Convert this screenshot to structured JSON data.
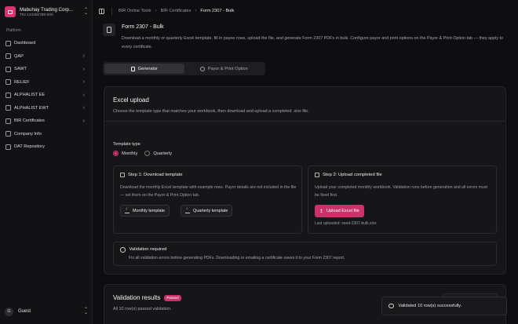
{
  "org": {
    "name": "Mabuhay Trading Corp...",
    "tin": "TIN 123456789-000"
  },
  "sidebar": {
    "section_title": "Platform",
    "items": [
      {
        "label": "Dashboard",
        "has_chevron": false
      },
      {
        "label": "QAP",
        "has_chevron": true
      },
      {
        "label": "SAWT",
        "has_chevron": true
      },
      {
        "label": "RELIEF",
        "has_chevron": true
      },
      {
        "label": "ALPHALIST EE",
        "has_chevron": true
      },
      {
        "label": "ALPHALIST EWT",
        "has_chevron": true
      },
      {
        "label": "BIR Certificates",
        "has_chevron": true
      },
      {
        "label": "Company Info",
        "has_chevron": false
      },
      {
        "label": "DAT Repository",
        "has_chevron": false
      }
    ],
    "user": {
      "initial": "G",
      "name": "Guest"
    }
  },
  "breadcrumb": {
    "items": [
      "BIR Online Tools",
      "BIR Certificates",
      "Form 2307 - Bulk"
    ],
    "separator": "›"
  },
  "header": {
    "title": "Form 2307 - Bulk",
    "description": "Download a monthly or quarterly Excel template, fill in payee rows, upload the file, and generate Form 2307 PDFs in bulk. Configure payor and print options on the Payor & Print Option tab — they apply to every certificate."
  },
  "tabs": [
    {
      "label": "Generator",
      "active": true
    },
    {
      "label": "Payor & Print Option",
      "active": false
    }
  ],
  "excel_upload": {
    "title": "Excel upload",
    "subtitle": "Choose the template type that matches your workbook, then download and upload a completed .xlsx file.",
    "template_type_label": "Template type",
    "options": [
      {
        "label": "Monthly",
        "selected": true
      },
      {
        "label": "Quarterly",
        "selected": false
      }
    ],
    "step1": {
      "title": "Step 1: Download template",
      "text": "Download the monthly Excel template with example rows. Payor details are not included in the file — set them on the Payor & Print Option tab.",
      "monthly_btn": "Monthly template",
      "quarterly_btn": "Quarterly template"
    },
    "step2": {
      "title": "Step 2: Upload completed file",
      "text": "Upload your completed monthly workbook. Validation runs before generation and all errors must be fixed first.",
      "upload_btn": "Upload Excel file",
      "last_uploaded": "Last uploaded: seed-2307-bulk.xlsx"
    },
    "validation_required": {
      "title": "Validation required",
      "text": "Fix all validation errors before generating PDFs. Downloading or emailing a certificate saves it to your Form 2307 report."
    }
  },
  "validation_results": {
    "title": "Validation results",
    "badge": "Passed",
    "subtitle": "All 10 row(s) passed validation."
  },
  "toast": {
    "message": "Validated 10 row(s) successfully."
  },
  "colors": {
    "accent": "#c8336a",
    "background": "#0e0e10",
    "card": "#161618"
  }
}
